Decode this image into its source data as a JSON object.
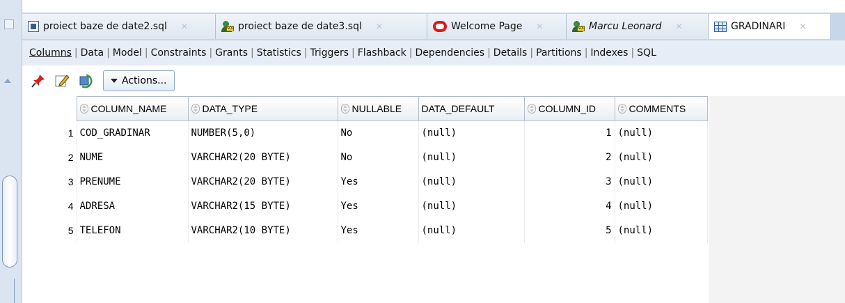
{
  "tabs": [
    {
      "label": "proiect baze de date2.sql",
      "icon": "sql-file-icon",
      "italic": false,
      "active": false
    },
    {
      "label": "proiect baze de date3.sql",
      "icon": "sql-connection-icon",
      "italic": false,
      "active": false
    },
    {
      "label": "Welcome Page",
      "icon": "oracle-icon",
      "italic": false,
      "active": false
    },
    {
      "label": "Marcu Leonard",
      "icon": "sql-connection-icon",
      "italic": true,
      "active": false
    },
    {
      "label": "GRADINARI",
      "icon": "table-icon",
      "italic": false,
      "active": true
    }
  ],
  "subtabs": [
    "Columns",
    "Data",
    "Model",
    "Constraints",
    "Grants",
    "Statistics",
    "Triggers",
    "Flashback",
    "Dependencies",
    "Details",
    "Partitions",
    "Indexes",
    "SQL"
  ],
  "toolbar": {
    "actions_label": "Actions..."
  },
  "grid": {
    "columns": [
      "COLUMN_NAME",
      "DATA_TYPE",
      "NULLABLE",
      "DATA_DEFAULT",
      "COLUMN_ID",
      "COMMENTS"
    ],
    "rows": [
      {
        "num": "1",
        "name": "COD_GRADINAR",
        "type": "NUMBER(5,0)",
        "nullable": "No",
        "default": "(null)",
        "id": "1",
        "comments": "(null)"
      },
      {
        "num": "2",
        "name": "NUME",
        "type": "VARCHAR2(20 BYTE)",
        "nullable": "No",
        "default": "(null)",
        "id": "2",
        "comments": "(null)"
      },
      {
        "num": "3",
        "name": "PRENUME",
        "type": "VARCHAR2(20 BYTE)",
        "nullable": "Yes",
        "default": "(null)",
        "id": "3",
        "comments": "(null)"
      },
      {
        "num": "4",
        "name": "ADRESA",
        "type": "VARCHAR2(15 BYTE)",
        "nullable": "Yes",
        "default": "(null)",
        "id": "4",
        "comments": "(null)"
      },
      {
        "num": "5",
        "name": "TELEFON",
        "type": "VARCHAR2(10 BYTE)",
        "nullable": "Yes",
        "default": "(null)",
        "id": "5",
        "comments": "(null)"
      }
    ]
  }
}
